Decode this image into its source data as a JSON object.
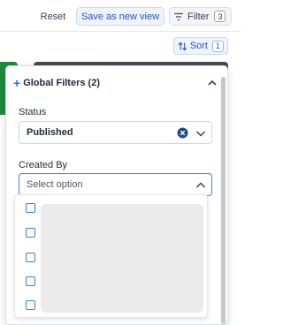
{
  "toolbar": {
    "reset_label": "Reset",
    "save_view_label": "Save as new view",
    "filter_label": "Filter",
    "filter_count": "3",
    "sort_label": "Sort",
    "sort_count": "1"
  },
  "filter_panel": {
    "title": "Global Filters (2)",
    "status": {
      "label": "Status",
      "value": "Published"
    },
    "created_by": {
      "label": "Created By",
      "placeholder": "Select option",
      "options_count": 5
    }
  },
  "colors": {
    "accent": "#2255c4",
    "accent_bg": "#eef4ff",
    "green_card": "#1f8a3b",
    "dark_card": "#454a52"
  }
}
